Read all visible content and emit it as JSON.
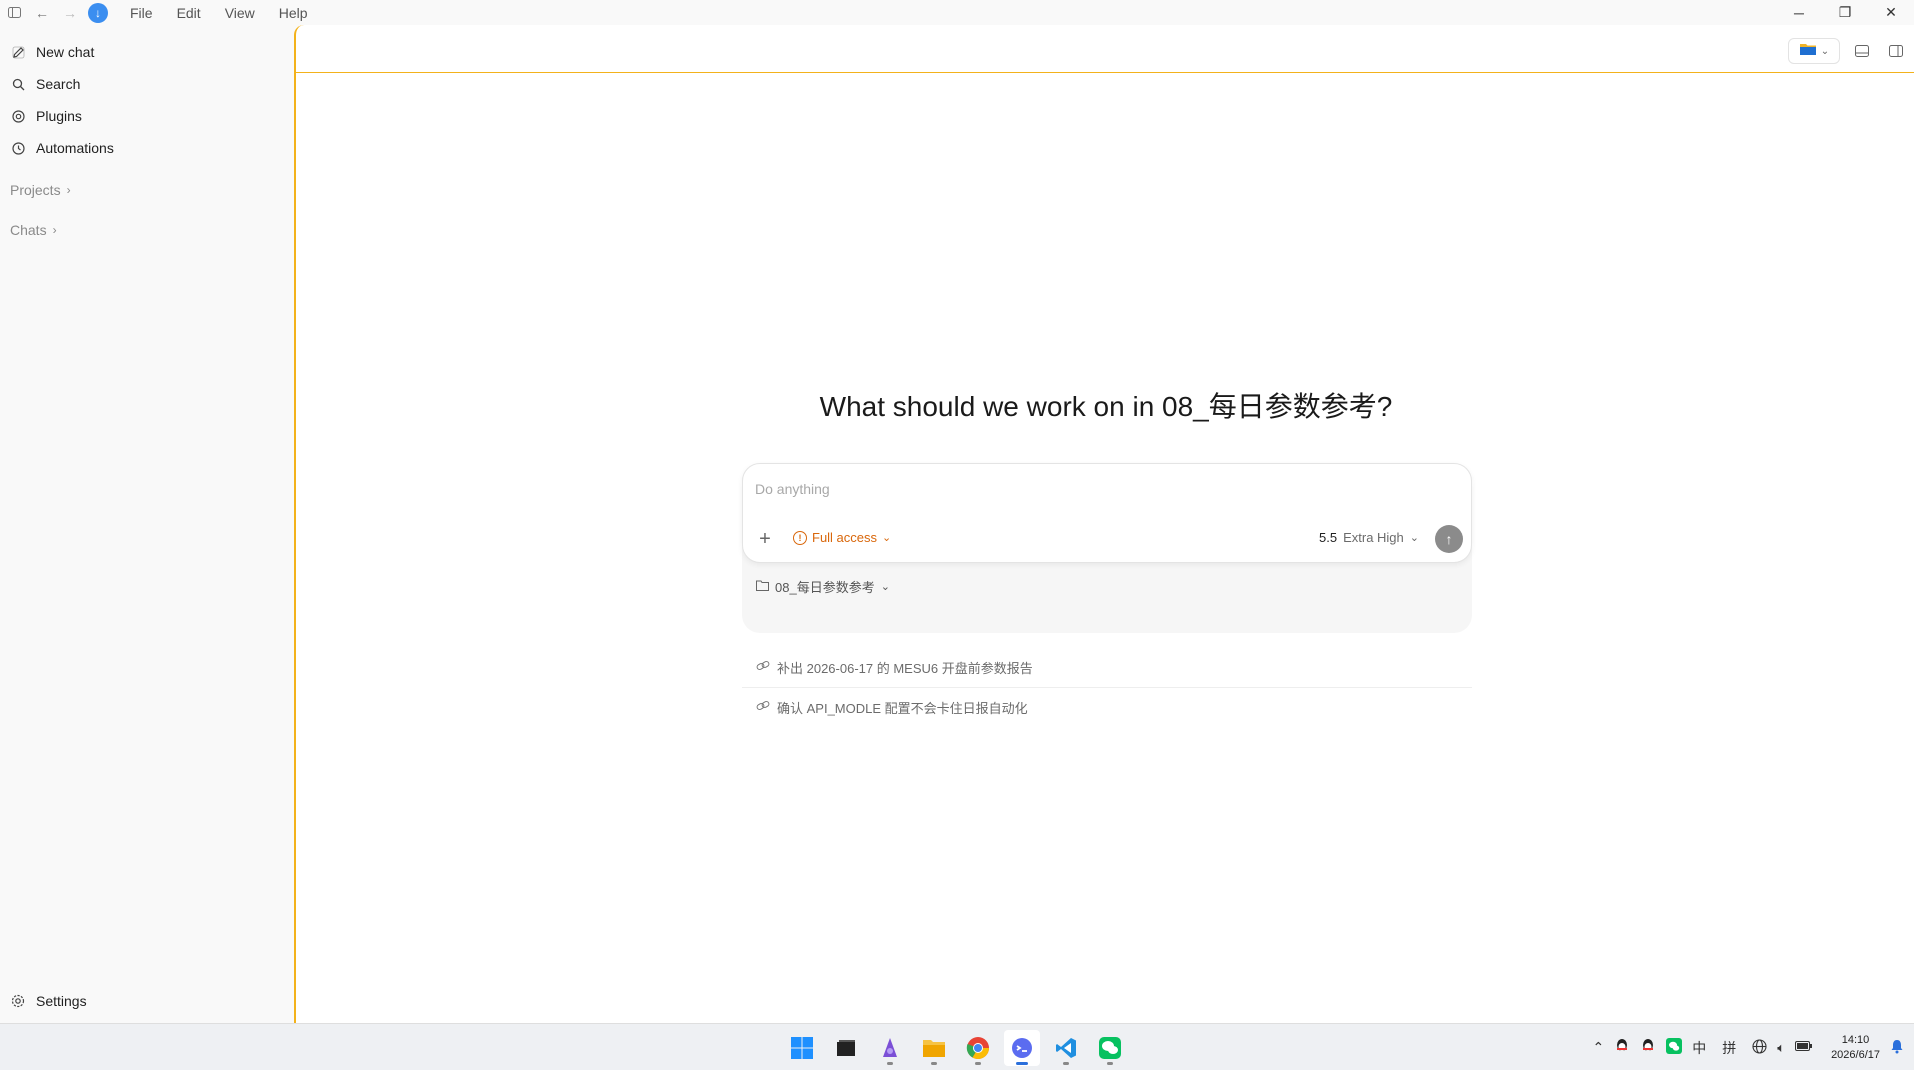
{
  "titlebar": {
    "menus": [
      "File",
      "Edit",
      "View",
      "Help"
    ]
  },
  "sidebar": {
    "items": [
      {
        "label": "New chat",
        "icon": "edit-icon"
      },
      {
        "label": "Search",
        "icon": "search-icon"
      },
      {
        "label": "Plugins",
        "icon": "plugin-icon"
      },
      {
        "label": "Automations",
        "icon": "clock-icon"
      }
    ],
    "projects_label": "Projects",
    "chats_label": "Chats",
    "settings_label": "Settings"
  },
  "main": {
    "heading": "What should we work on in 08_每日参数参考?",
    "composer": {
      "placeholder": "Do anything",
      "access_label": "Full access",
      "model_version": "5.5",
      "model_effort": "Extra High",
      "folder_label": "08_每日参数参考"
    },
    "suggestions": [
      "补出 2026-06-17 的 MESU6 开盘前参数报告",
      "确认 API_MODLE 配置不会卡住日报自动化"
    ]
  },
  "taskbar": {
    "tray_lang": "中",
    "tray_ime": "拼",
    "time": "14:10",
    "date": "2026/6/17"
  },
  "colors": {
    "accent": "#f3b21b",
    "warning": "#d9670b",
    "update_badge": "#3b8ef0"
  }
}
